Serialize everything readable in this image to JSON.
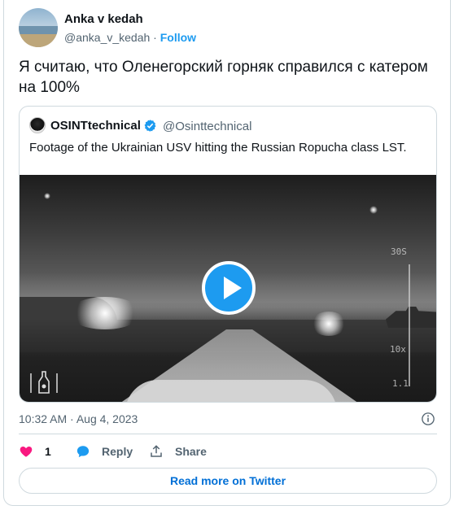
{
  "author": {
    "name": "Anka v kedah",
    "handle": "@anka_v_kedah",
    "separator": " · ",
    "follow_label": "Follow"
  },
  "tweet": {
    "text": "Я считаю, что Оленегорский горняк справился с катером на 100%",
    "timestamp": "10:32 AM · Aug 4, 2023"
  },
  "quote": {
    "name": "OSINTtechnical",
    "handle": "@Osinttechnical",
    "text": "Footage of the Ukrainian USV hitting the Russian Ropucha class LST.",
    "video_overlay": {
      "top_label": "30S",
      "mid_label": "10x",
      "bottom_label": "1.1"
    }
  },
  "actions": {
    "like_count": "1",
    "reply_label": "Reply",
    "share_label": "Share"
  },
  "footer": {
    "read_more_label": "Read more on Twitter"
  },
  "colors": {
    "accent": "#1d9bf0",
    "like": "#f91880",
    "text_secondary": "#536471",
    "border": "#cfd9de"
  },
  "icons": [
    "heart-icon",
    "reply-bubble-icon",
    "share-icon",
    "info-icon",
    "verified-badge-icon",
    "play-icon"
  ]
}
